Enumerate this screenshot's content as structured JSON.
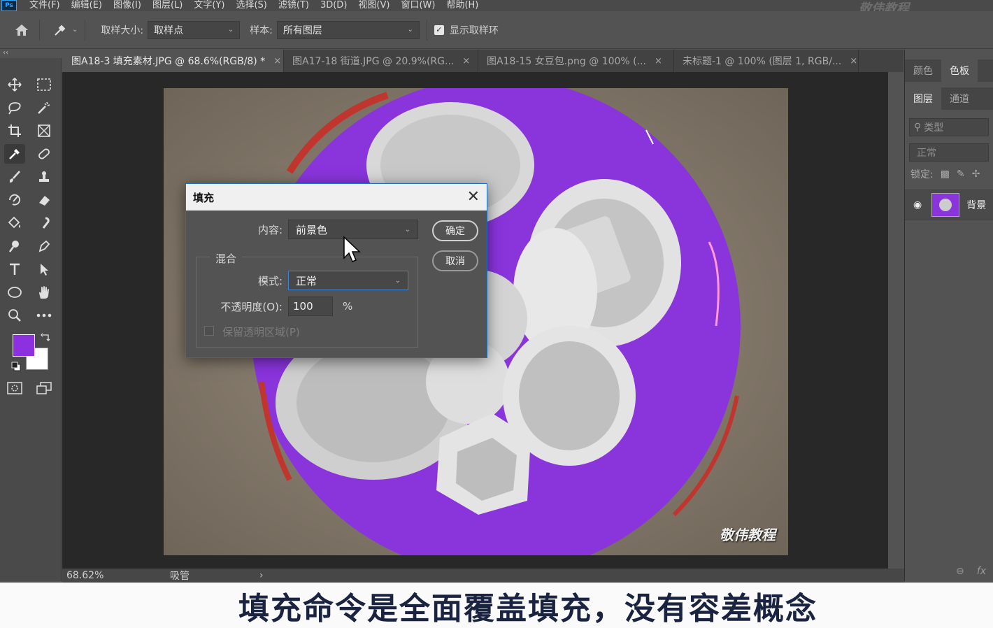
{
  "menubar": {
    "logo": "Ps",
    "menus": [
      "文件(F)",
      "编辑(E)",
      "图像(I)",
      "图层(L)",
      "文字(Y)",
      "选择(S)",
      "滤镜(T)",
      "3D(D)",
      "视图(V)",
      "窗口(W)",
      "帮助(H)"
    ],
    "brand": "敬伟教程"
  },
  "options": {
    "sample_size_label": "取样大小:",
    "sample_size_value": "取样点",
    "sample_label": "样本:",
    "sample_value": "所有图层",
    "show_ring_label": "显示取样环",
    "show_ring_checked": "✓"
  },
  "tabs": [
    {
      "label": "图A18-3 填充素材.JPG @ 68.6%(RGB/8) *",
      "close": "×"
    },
    {
      "label": "图A17-18 街道.JPG @ 20.9%(RG...",
      "close": "×"
    },
    {
      "label": "图A18-15 女豆包.png @ 100% (...",
      "close": "×"
    },
    {
      "label": "未标题-1 @ 100% (图层 1, RGB/...",
      "close": "×"
    }
  ],
  "collapse": "‹‹",
  "statusbar": {
    "zoom": "68.62%",
    "tool": "吸管",
    "arrow": "›"
  },
  "panels": {
    "top_tabs": [
      "颜色",
      "色板"
    ],
    "layer_tabs": [
      "图层",
      "通道"
    ],
    "filter_placeholder": "类型",
    "blend_mode": "正常",
    "lock_label": "锁定:",
    "layer_name": "背景"
  },
  "dialog": {
    "title": "填充",
    "close": "✕",
    "content_label": "内容:",
    "content_value": "前景色",
    "blend_group": "混合",
    "mode_label": "模式:",
    "mode_value": "正常",
    "opacity_label": "不透明度(O):",
    "opacity_value": "100",
    "opacity_unit": "%",
    "preserve_label": "保留透明区域(P)",
    "ok": "确定",
    "cancel": "取消"
  },
  "canvas_watermark": "敬伟教程",
  "subtitle": "填充命令是全面覆盖填充，没有容差概念",
  "colors": {
    "foreground": "#8c30e0",
    "background": "#ffffff",
    "fill_purple": "#8a34dc"
  }
}
